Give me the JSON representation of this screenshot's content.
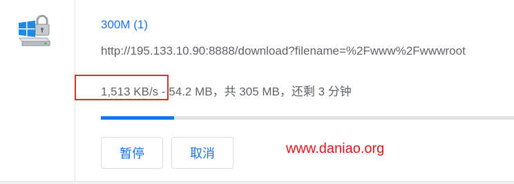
{
  "download": {
    "file_icon": "windows-installer-lock-icon",
    "title": "300M (1)",
    "url": "http://195.133.10.90:8888/download?filename=%2Fwww%2Fwwwroot",
    "speed": "1,513 KB/s",
    "status_rest": " - 54.2 MB，共 305 MB，还剩 3 分钟",
    "progress_fraction": 0.178,
    "pause_label": "暂停",
    "cancel_label": "取消"
  },
  "watermark": "www.daniao.org",
  "colors": {
    "accent": "#1a73e8",
    "highlight": "#d9302c",
    "watermark": "#e0141a"
  }
}
